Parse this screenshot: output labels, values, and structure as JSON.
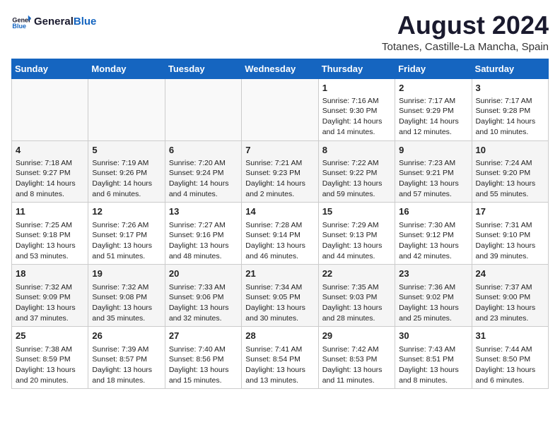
{
  "header": {
    "logo_line1": "General",
    "logo_line2": "Blue",
    "month": "August 2024",
    "location": "Totanes, Castille-La Mancha, Spain"
  },
  "days_of_week": [
    "Sunday",
    "Monday",
    "Tuesday",
    "Wednesday",
    "Thursday",
    "Friday",
    "Saturday"
  ],
  "weeks": [
    [
      {
        "day": "",
        "info": ""
      },
      {
        "day": "",
        "info": ""
      },
      {
        "day": "",
        "info": ""
      },
      {
        "day": "",
        "info": ""
      },
      {
        "day": "1",
        "info": "Sunrise: 7:16 AM\nSunset: 9:30 PM\nDaylight: 14 hours and 14 minutes."
      },
      {
        "day": "2",
        "info": "Sunrise: 7:17 AM\nSunset: 9:29 PM\nDaylight: 14 hours and 12 minutes."
      },
      {
        "day": "3",
        "info": "Sunrise: 7:17 AM\nSunset: 9:28 PM\nDaylight: 14 hours and 10 minutes."
      }
    ],
    [
      {
        "day": "4",
        "info": "Sunrise: 7:18 AM\nSunset: 9:27 PM\nDaylight: 14 hours and 8 minutes."
      },
      {
        "day": "5",
        "info": "Sunrise: 7:19 AM\nSunset: 9:26 PM\nDaylight: 14 hours and 6 minutes."
      },
      {
        "day": "6",
        "info": "Sunrise: 7:20 AM\nSunset: 9:24 PM\nDaylight: 14 hours and 4 minutes."
      },
      {
        "day": "7",
        "info": "Sunrise: 7:21 AM\nSunset: 9:23 PM\nDaylight: 14 hours and 2 minutes."
      },
      {
        "day": "8",
        "info": "Sunrise: 7:22 AM\nSunset: 9:22 PM\nDaylight: 13 hours and 59 minutes."
      },
      {
        "day": "9",
        "info": "Sunrise: 7:23 AM\nSunset: 9:21 PM\nDaylight: 13 hours and 57 minutes."
      },
      {
        "day": "10",
        "info": "Sunrise: 7:24 AM\nSunset: 9:20 PM\nDaylight: 13 hours and 55 minutes."
      }
    ],
    [
      {
        "day": "11",
        "info": "Sunrise: 7:25 AM\nSunset: 9:18 PM\nDaylight: 13 hours and 53 minutes."
      },
      {
        "day": "12",
        "info": "Sunrise: 7:26 AM\nSunset: 9:17 PM\nDaylight: 13 hours and 51 minutes."
      },
      {
        "day": "13",
        "info": "Sunrise: 7:27 AM\nSunset: 9:16 PM\nDaylight: 13 hours and 48 minutes."
      },
      {
        "day": "14",
        "info": "Sunrise: 7:28 AM\nSunset: 9:14 PM\nDaylight: 13 hours and 46 minutes."
      },
      {
        "day": "15",
        "info": "Sunrise: 7:29 AM\nSunset: 9:13 PM\nDaylight: 13 hours and 44 minutes."
      },
      {
        "day": "16",
        "info": "Sunrise: 7:30 AM\nSunset: 9:12 PM\nDaylight: 13 hours and 42 minutes."
      },
      {
        "day": "17",
        "info": "Sunrise: 7:31 AM\nSunset: 9:10 PM\nDaylight: 13 hours and 39 minutes."
      }
    ],
    [
      {
        "day": "18",
        "info": "Sunrise: 7:32 AM\nSunset: 9:09 PM\nDaylight: 13 hours and 37 minutes."
      },
      {
        "day": "19",
        "info": "Sunrise: 7:32 AM\nSunset: 9:08 PM\nDaylight: 13 hours and 35 minutes."
      },
      {
        "day": "20",
        "info": "Sunrise: 7:33 AM\nSunset: 9:06 PM\nDaylight: 13 hours and 32 minutes."
      },
      {
        "day": "21",
        "info": "Sunrise: 7:34 AM\nSunset: 9:05 PM\nDaylight: 13 hours and 30 minutes."
      },
      {
        "day": "22",
        "info": "Sunrise: 7:35 AM\nSunset: 9:03 PM\nDaylight: 13 hours and 28 minutes."
      },
      {
        "day": "23",
        "info": "Sunrise: 7:36 AM\nSunset: 9:02 PM\nDaylight: 13 hours and 25 minutes."
      },
      {
        "day": "24",
        "info": "Sunrise: 7:37 AM\nSunset: 9:00 PM\nDaylight: 13 hours and 23 minutes."
      }
    ],
    [
      {
        "day": "25",
        "info": "Sunrise: 7:38 AM\nSunset: 8:59 PM\nDaylight: 13 hours and 20 minutes."
      },
      {
        "day": "26",
        "info": "Sunrise: 7:39 AM\nSunset: 8:57 PM\nDaylight: 13 hours and 18 minutes."
      },
      {
        "day": "27",
        "info": "Sunrise: 7:40 AM\nSunset: 8:56 PM\nDaylight: 13 hours and 15 minutes."
      },
      {
        "day": "28",
        "info": "Sunrise: 7:41 AM\nSunset: 8:54 PM\nDaylight: 13 hours and 13 minutes."
      },
      {
        "day": "29",
        "info": "Sunrise: 7:42 AM\nSunset: 8:53 PM\nDaylight: 13 hours and 11 minutes."
      },
      {
        "day": "30",
        "info": "Sunrise: 7:43 AM\nSunset: 8:51 PM\nDaylight: 13 hours and 8 minutes."
      },
      {
        "day": "31",
        "info": "Sunrise: 7:44 AM\nSunset: 8:50 PM\nDaylight: 13 hours and 6 minutes."
      }
    ]
  ]
}
